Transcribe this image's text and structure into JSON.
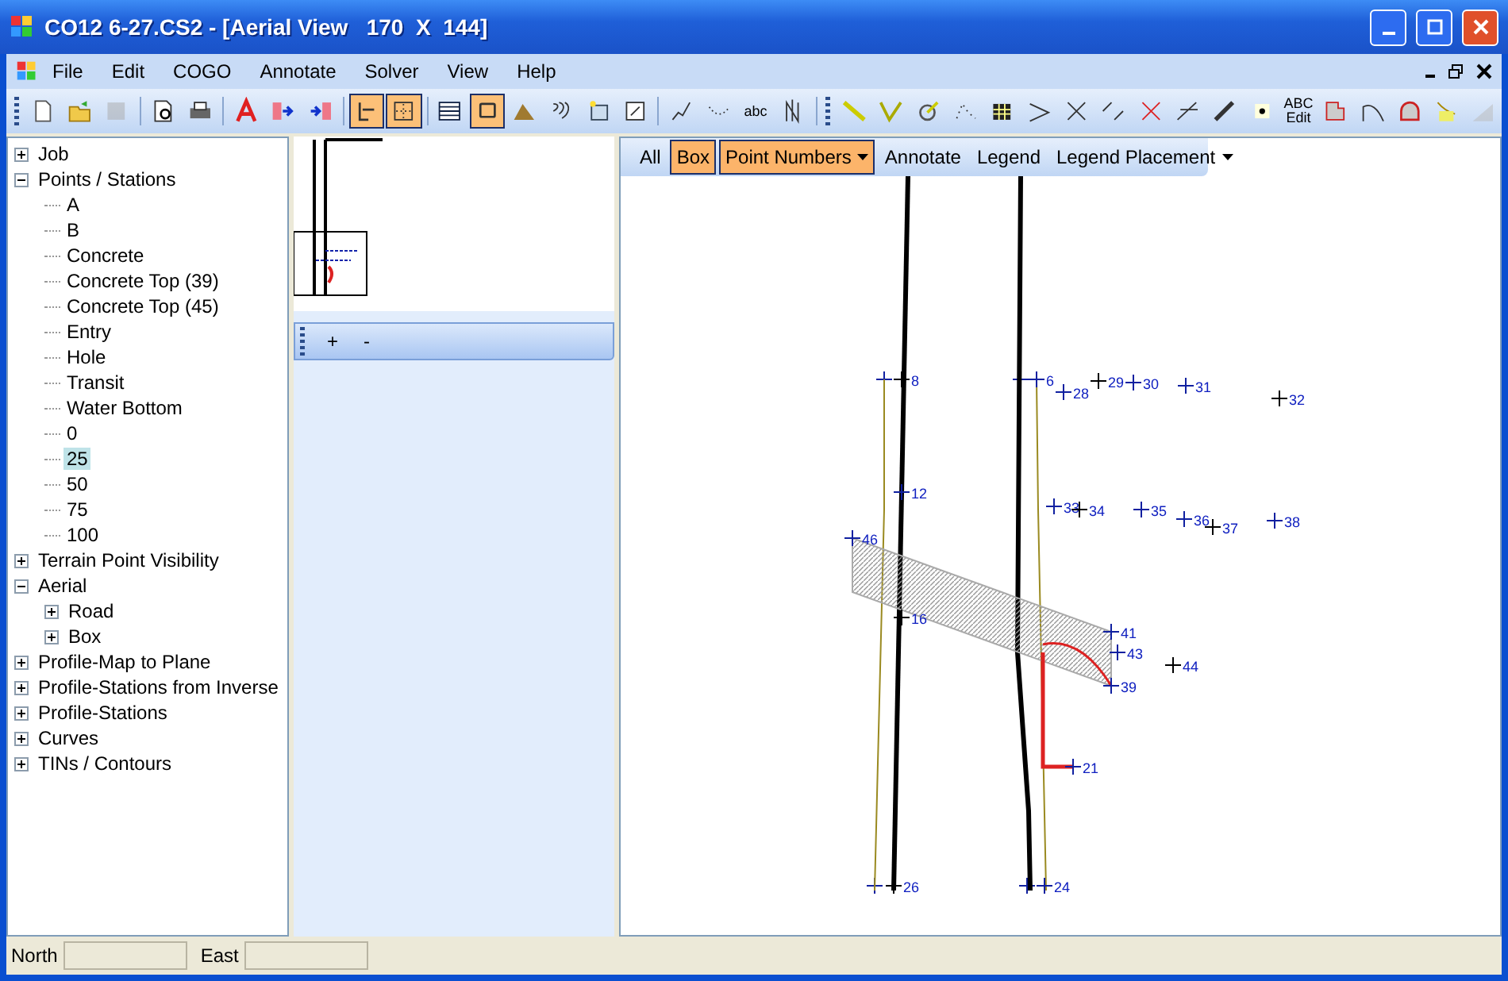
{
  "window": {
    "title": "CO12 6-27.CS2 - [Aerial View   170  X  144]"
  },
  "menu": [
    "File",
    "Edit",
    "COGO",
    "Annotate",
    "Solver",
    "View",
    "Help"
  ],
  "toolbar": [
    {
      "kind": "icon",
      "selected": false,
      "disabled": false
    },
    {
      "kind": "icon",
      "selected": false,
      "disabled": false
    },
    {
      "kind": "icon",
      "selected": false,
      "disabled": true
    },
    {
      "kind": "separator"
    },
    {
      "kind": "icon",
      "selected": false,
      "disabled": false
    },
    {
      "kind": "icon",
      "selected": false,
      "disabled": false
    },
    {
      "kind": "separator"
    },
    {
      "kind": "icon",
      "selected": false,
      "disabled": false
    },
    {
      "kind": "icon",
      "selected": false,
      "disabled": false
    },
    {
      "kind": "icon",
      "selected": false,
      "disabled": false
    },
    {
      "kind": "separator"
    },
    {
      "kind": "icon",
      "selected": true,
      "disabled": false
    },
    {
      "kind": "icon",
      "selected": true,
      "disabled": false
    },
    {
      "kind": "separator"
    },
    {
      "kind": "icon",
      "selected": false,
      "disabled": false
    },
    {
      "kind": "icon",
      "selected": true,
      "disabled": false
    },
    {
      "kind": "icon",
      "selected": false,
      "disabled": false
    },
    {
      "kind": "icon",
      "selected": false,
      "disabled": false
    },
    {
      "kind": "icon",
      "selected": false,
      "disabled": false
    },
    {
      "kind": "icon",
      "selected": false,
      "disabled": false
    },
    {
      "kind": "separator"
    },
    {
      "kind": "icon",
      "selected": false,
      "disabled": false
    },
    {
      "kind": "icon",
      "selected": false,
      "disabled": false
    },
    {
      "kind": "text",
      "label": "abc",
      "selected": false,
      "disabled": false
    },
    {
      "kind": "icon",
      "selected": false,
      "disabled": false
    },
    {
      "kind": "break"
    },
    {
      "kind": "icon",
      "selected": false,
      "disabled": false
    },
    {
      "kind": "icon",
      "selected": false,
      "disabled": false
    },
    {
      "kind": "icon",
      "selected": false,
      "disabled": false
    },
    {
      "kind": "icon",
      "selected": false,
      "disabled": false
    },
    {
      "kind": "icon",
      "selected": false,
      "disabled": false
    },
    {
      "kind": "icon",
      "selected": false,
      "disabled": false
    },
    {
      "kind": "icon",
      "selected": false,
      "disabled": false
    },
    {
      "kind": "icon",
      "selected": false,
      "disabled": false
    },
    {
      "kind": "icon",
      "selected": false,
      "disabled": false
    },
    {
      "kind": "icon",
      "selected": false,
      "disabled": false
    },
    {
      "kind": "icon",
      "selected": false,
      "disabled": false
    },
    {
      "kind": "icon",
      "selected": false,
      "disabled": false
    },
    {
      "kind": "text",
      "label": "ABC Edit",
      "selected": false,
      "disabled": false
    },
    {
      "kind": "icon",
      "selected": false,
      "disabled": false
    },
    {
      "kind": "icon",
      "selected": false,
      "disabled": false
    },
    {
      "kind": "icon",
      "selected": false,
      "disabled": false
    },
    {
      "kind": "icon",
      "selected": false,
      "disabled": false
    },
    {
      "kind": "icon",
      "selected": false,
      "disabled": true
    }
  ],
  "tree": [
    {
      "label": "Job",
      "expanded": false,
      "selected": false
    },
    {
      "label": "Points / Stations",
      "expanded": true,
      "selected": false,
      "children": [
        {
          "label": "A",
          "selected": false
        },
        {
          "label": "B",
          "selected": false
        },
        {
          "label": "Concrete",
          "selected": false
        },
        {
          "label": "Concrete Top (39)",
          "selected": false
        },
        {
          "label": "Concrete Top (45)",
          "selected": false
        },
        {
          "label": "Entry",
          "selected": false
        },
        {
          "label": "Hole",
          "selected": false
        },
        {
          "label": "Transit",
          "selected": false
        },
        {
          "label": "Water Bottom",
          "selected": false
        },
        {
          "label": "0",
          "selected": false
        },
        {
          "label": "25",
          "selected": true
        },
        {
          "label": "50",
          "selected": false
        },
        {
          "label": "75",
          "selected": false
        },
        {
          "label": "100",
          "selected": false
        }
      ]
    },
    {
      "label": "Terrain Point Visibility",
      "expanded": false,
      "selected": false
    },
    {
      "label": "Aerial",
      "expanded": true,
      "selected": false,
      "children": [
        {
          "label": "Road",
          "expanded": false,
          "selected": false
        },
        {
          "label": "Box",
          "expanded": false,
          "selected": false
        }
      ]
    },
    {
      "label": "Profile-Map to Plane",
      "expanded": false,
      "selected": false
    },
    {
      "label": "Profile-Stations from Inverse",
      "expanded": false,
      "selected": false
    },
    {
      "label": "Profile-Stations",
      "expanded": false,
      "selected": false
    },
    {
      "label": "Curves",
      "expanded": false,
      "selected": false
    },
    {
      "label": "TINs / Contours",
      "expanded": false,
      "selected": false
    }
  ],
  "zoom_toolbar": [
    "+",
    "-"
  ],
  "view_toolbar": [
    {
      "label": "All",
      "selected": false,
      "dropdown": false
    },
    {
      "label": "Box",
      "selected": true,
      "dropdown": false
    },
    {
      "label": "Point Numbers",
      "selected": true,
      "dropdown": true
    },
    {
      "label": "Annotate",
      "selected": false,
      "dropdown": false
    },
    {
      "label": "Legend",
      "selected": false,
      "dropdown": false
    },
    {
      "label": "Legend Placement",
      "selected": false,
      "dropdown": true
    }
  ],
  "points": [
    "8",
    "6",
    "28",
    "29",
    "30",
    "31",
    "32",
    "12",
    "33",
    "34",
    "35",
    "36",
    "37",
    "38",
    "46",
    "16",
    "41",
    "43",
    "44",
    "39",
    "21",
    "26",
    "24"
  ],
  "status_bar": [
    {
      "label": "North"
    },
    {
      "label": "East"
    }
  ]
}
